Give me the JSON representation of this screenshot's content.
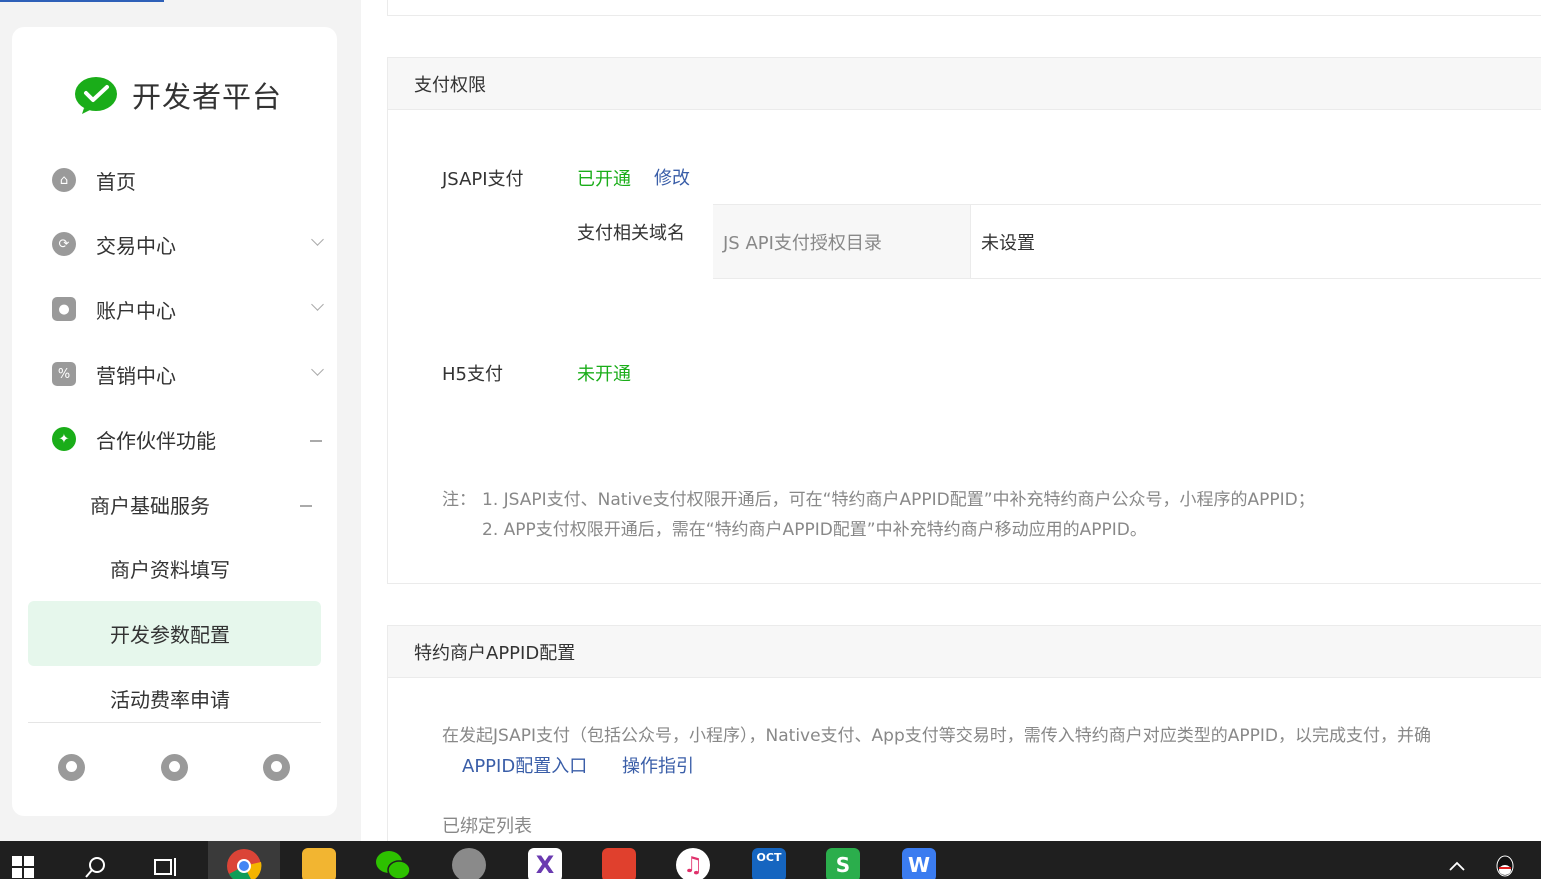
{
  "sidebar": {
    "logo_text": "开发者平台",
    "nav": [
      {
        "label": "首页",
        "icon": "home-icon"
      },
      {
        "label": "交易中心",
        "icon": "exchange-icon"
      },
      {
        "label": "账户中心",
        "icon": "account-icon"
      },
      {
        "label": "营销中心",
        "icon": "percent-icon"
      },
      {
        "label": "合作伙伴功能",
        "icon": "partner-icon"
      }
    ],
    "sub_group": "商户基础服务",
    "sub_items": [
      "商户资料填写",
      "开发参数配置",
      "活动费率申请"
    ],
    "active_item": "开发参数配置",
    "footer_icons": [
      "announcement-icon",
      "notification-icon",
      "user-icon"
    ]
  },
  "payment_permission": {
    "title": "支付权限",
    "jsapi_label": "JSAPI支付",
    "jsapi_status": "已开通",
    "jsapi_edit": "修改",
    "domain_label": "支付相关域名",
    "domain_th": "JS API支付授权目录",
    "domain_td": "未设置",
    "h5_label": "H5支付",
    "h5_status": "未开通",
    "note_prefix": "注：",
    "note_1": "1. JSAPI支付、Native支付权限开通后，可在“特约商户APPID配置”中补充特约商户公众号，小程序的APPID；",
    "note_2": "2. APP支付权限开通后，需在“特约商户APPID配置”中补充特约商户移动应用的APPID。"
  },
  "appid_config": {
    "title": "特约商户APPID配置",
    "desc": "在发起JSAPI支付（包括公众号，小程序），Native支付、App支付等交易时，需传入特约商户对应类型的APPID，以完成支付，并确",
    "link_entry": "APPID配置入口",
    "link_guide": "操作指引",
    "bound_list": "已绑定列表"
  },
  "colors": {
    "brand_green": "#1aad19",
    "link_blue": "#3a5ea8",
    "active_bg": "#e6f7ec"
  },
  "taskbar": {
    "icons": [
      "windows-start-icon",
      "search-icon",
      "task-view-icon",
      "chrome-icon",
      "file-explorer-icon",
      "wechat-icon",
      "parrot-app-icon",
      "xmind-icon",
      "xmind-red-icon",
      "music-icon",
      "ocr-app-icon",
      "wps-sheet-icon",
      "wps-writer-icon",
      "tray-up-icon",
      "qq-icon"
    ]
  }
}
